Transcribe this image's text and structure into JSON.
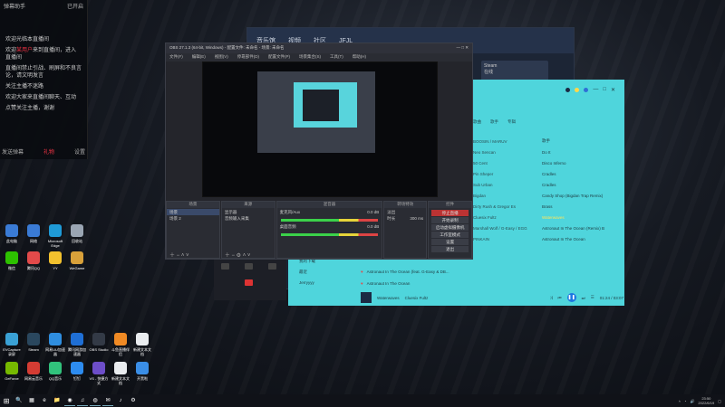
{
  "chat": {
    "title": "弹幕助手",
    "badge": "已开启",
    "messages": [
      {
        "text": "欢迎光临本直播间"
      },
      {
        "prefix": "欢迎",
        "highlight": "某用户",
        "suffix": "来到直播间，进入直播间"
      },
      {
        "text": "直播间禁止引战、刷屏和不良言论，请文明发言"
      },
      {
        "text": "关注主播不迷路"
      },
      {
        "text": "欢迎大家来直播间聊天、互动"
      },
      {
        "text": "点赞关注主播，谢谢"
      }
    ],
    "footer_left": "发送弹幕",
    "footer_mid": "礼物",
    "footer_right": "设置"
  },
  "desktop_icons": [
    {
      "label": "此电脑",
      "color": "#3a7bd5"
    },
    {
      "label": "网络",
      "color": "#3a7bd5"
    },
    {
      "label": "Microsoft Edge",
      "color": "#1f9ad6"
    },
    {
      "label": "回收站",
      "color": "#9aa5b3"
    },
    {
      "label": "微信",
      "color": "#2dc100"
    },
    {
      "label": "腾讯QQ",
      "color": "#e24a4a"
    },
    {
      "label": "YY",
      "color": "#f2c12e"
    },
    {
      "label": "WeGame",
      "color": "#d9a13a"
    },
    {
      "label": "EVCapture 录屏",
      "color": "#3aa1d5"
    },
    {
      "label": "Steam",
      "color": "#2a475e"
    },
    {
      "label": "网易UU加速器",
      "color": "#2f8ee0"
    },
    {
      "label": "腾讯网游加速器",
      "color": "#1f6fd5"
    },
    {
      "label": "OBS Studio",
      "color": "#333a46"
    },
    {
      "label": "斗鱼直播伴侣",
      "color": "#f08a24"
    },
    {
      "label": "新建文本文档",
      "color": "#e9ecef"
    },
    {
      "label": "GeForce",
      "color": "#76b900"
    },
    {
      "label": "网易云音乐",
      "color": "#d43c33"
    },
    {
      "label": "QQ音乐",
      "color": "#31c27c"
    },
    {
      "label": "钉钉",
      "color": "#2d8cf0"
    },
    {
      "label": "VS - 快捷方式",
      "color": "#6d4ec9"
    },
    {
      "label": "新建文本文档",
      "color": "#e9ecef"
    },
    {
      "label": "开黑啦",
      "color": "#3a8ee6"
    }
  ],
  "bg_window": {
    "nav": [
      "音乐馆",
      "视频",
      "社区",
      "JFJL"
    ],
    "profile": {
      "name": "Steam",
      "sub": "在线"
    }
  },
  "music": {
    "cols": [
      "歌曲",
      "歌手",
      "专辑"
    ],
    "songs": [
      {
        "artist": "BOOSIN / MARUV",
        "album": "歌手"
      },
      {
        "artist": "Neo Sencan",
        "album": "Do It"
      },
      {
        "artist": "50 Cent",
        "album": "Disco Inferno"
      },
      {
        "artist": "Pin Sheper",
        "album": "Cradles"
      },
      {
        "artist": "Sub Urban",
        "album": "Cradles"
      },
      {
        "artist": "Bigdan",
        "album": "Candy Shop (Bigdan Trap Remix)"
      },
      {
        "artist": "Dirty Rush & Gregor Es",
        "album": "Brass"
      },
      {
        "artist": "Cluesix Fultz",
        "album": "Waterwaves",
        "highlight": true
      },
      {
        "artist": "Marshall Wolf / G-Easy / EGG",
        "album": "Astronaut In The Ocean (Remix) B"
      },
      {
        "artist": "PINKAIN",
        "album": "Astronaut In The Ocean"
      }
    ],
    "left_rows": [
      "Astronaut In The Ocean (feat. G-Easy & DB...",
      "Astronaut In The Ocean"
    ],
    "sidebar": [
      "我的下载",
      "最近",
      "Jerryyyy"
    ],
    "player": {
      "title": "Waterwaves",
      "artist": "Cluesix Fultz",
      "time": "01:24 / 03:07"
    }
  },
  "obs": {
    "title": "OBS 27.1.3 (64-bit, Windows) - 配置文件: 未命名 - 场景: 未命名",
    "menu": [
      "文件(F)",
      "编辑(E)",
      "视图(V)",
      "停靠部件(D)",
      "配置文件(P)",
      "场景集合(S)",
      "工具(T)",
      "帮助(H)"
    ],
    "docks": {
      "scenes": {
        "header": "场景",
        "items": [
          "场景",
          "场景 2"
        ]
      },
      "sources": {
        "header": "来源",
        "items": [
          "显示器",
          "音频输入采集"
        ]
      },
      "mixer": {
        "header": "混音器",
        "rows": [
          {
            "label": "麦克风/Aux",
            "db": "0.0 dB"
          },
          {
            "label": "桌面音频",
            "db": "0.0 dB"
          }
        ]
      },
      "transitions": {
        "header": "转场特效",
        "value": "淡出",
        "duration_label": "时长",
        "duration": "300 ms"
      },
      "controls": {
        "header": "控件",
        "buttons": [
          "停止直播",
          "开始录制",
          "启动虚拟摄像机",
          "工作室模式",
          "设置",
          "退出"
        ]
      }
    }
  },
  "taskbar": {
    "start": "⊞",
    "icons": [
      "🔍",
      "▦",
      "e",
      "📁",
      "◉",
      "♫",
      "◍",
      "✉",
      "♪",
      "⚙"
    ],
    "time": "23:50",
    "date": "2022/6/19"
  }
}
